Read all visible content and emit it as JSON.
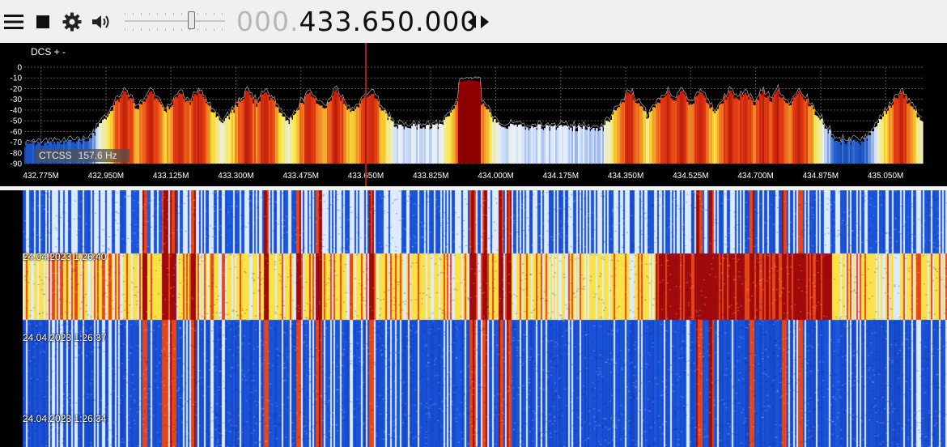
{
  "toolbar": {
    "menu_icon": "hamburger-menu-icon",
    "stop_icon": "stop-icon",
    "settings_icon": "gear-icon",
    "volume_icon": "speaker-icon",
    "volume_level": 0.68,
    "frequency_dim": "000.",
    "frequency_main": "433.650.000",
    "tune_icon": "left-right-arrows-icon"
  },
  "spectrum": {
    "dcs_label": "DCS + -",
    "ctcss_label": "CTCSS",
    "ctcss_value": "157.6 Hz",
    "db_ticks": [
      "0",
      "-10",
      "-20",
      "-30",
      "-40",
      "-50",
      "-60",
      "-70",
      "-80",
      "-90"
    ],
    "freq_ticks": [
      "432.775M",
      "432.950M",
      "433.125M",
      "433.300M",
      "433.475M",
      "433.650M",
      "433.825M",
      "434.000M",
      "434.175M",
      "434.350M",
      "434.525M",
      "434.700M",
      "434.875M",
      "435.050M"
    ],
    "freq_range_mhz": [
      432.73,
      435.15
    ],
    "tuned_freq_mhz": 433.65,
    "db_range": [
      -90,
      0
    ],
    "colors": {
      "marker": "#b01818",
      "grid": "#555555"
    }
  },
  "waterfall": {
    "timestamps": [
      "24.04.2023 1:26:40",
      "24.04.2023 1:26:37",
      "24.04.2023 1:26:34"
    ]
  }
}
